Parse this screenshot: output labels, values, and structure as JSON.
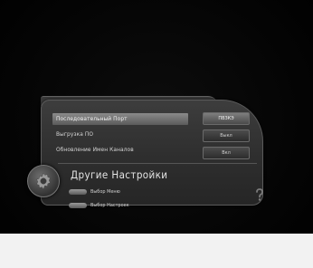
{
  "menu": {
    "items": [
      {
        "label": "Последовательный Порт",
        "value": "ПВЗКЭ",
        "selected": true
      },
      {
        "label": "Выгрузка ПО",
        "value": "Выкл"
      },
      {
        "label": "Обновление Имен Каналов",
        "value": "Вкл"
      }
    ]
  },
  "section": {
    "title": "Другие Настройки"
  },
  "hints": [
    {
      "key": "green-button",
      "label": "Выбор Меню"
    },
    {
      "key": "yellow-button",
      "label": "Выбор Настроек"
    }
  ],
  "icons": {
    "emblem": "gear-icon",
    "help": "help-icon"
  }
}
